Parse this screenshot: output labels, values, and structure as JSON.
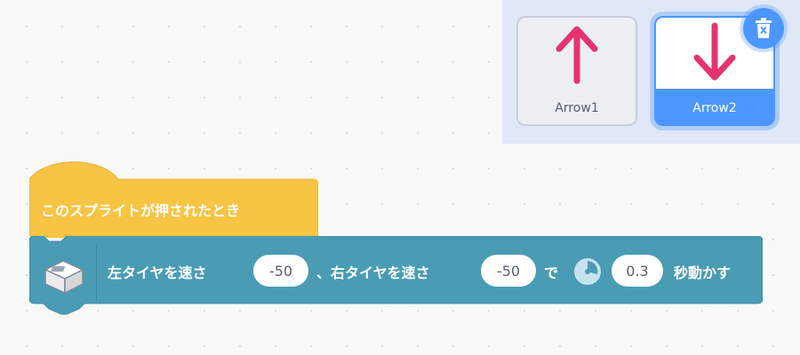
{
  "costumes": [
    {
      "name": "Arrow1",
      "icon": "arrow-up-icon",
      "color": "#e6336f",
      "selected": false
    },
    {
      "name": "Arrow2",
      "icon": "arrow-down-icon",
      "color": "#e6336f",
      "selected": true
    }
  ],
  "colors": {
    "event_block": "#f7c444",
    "motor_block": "#4a9cb5",
    "selected": "#4c97ff",
    "panel": "#e0e8f7"
  },
  "blocks": {
    "hat": {
      "label": "このスプライトが押されたとき"
    },
    "command": {
      "icon": "motor-icon",
      "text1": "左タイヤを速さ",
      "left_speed": "-50",
      "text2": "、右タイヤを速さ",
      "right_speed": "-50",
      "text3": "で",
      "timer_icon": "timer-icon",
      "seconds": "0.3",
      "text4": "秒動かす"
    }
  }
}
